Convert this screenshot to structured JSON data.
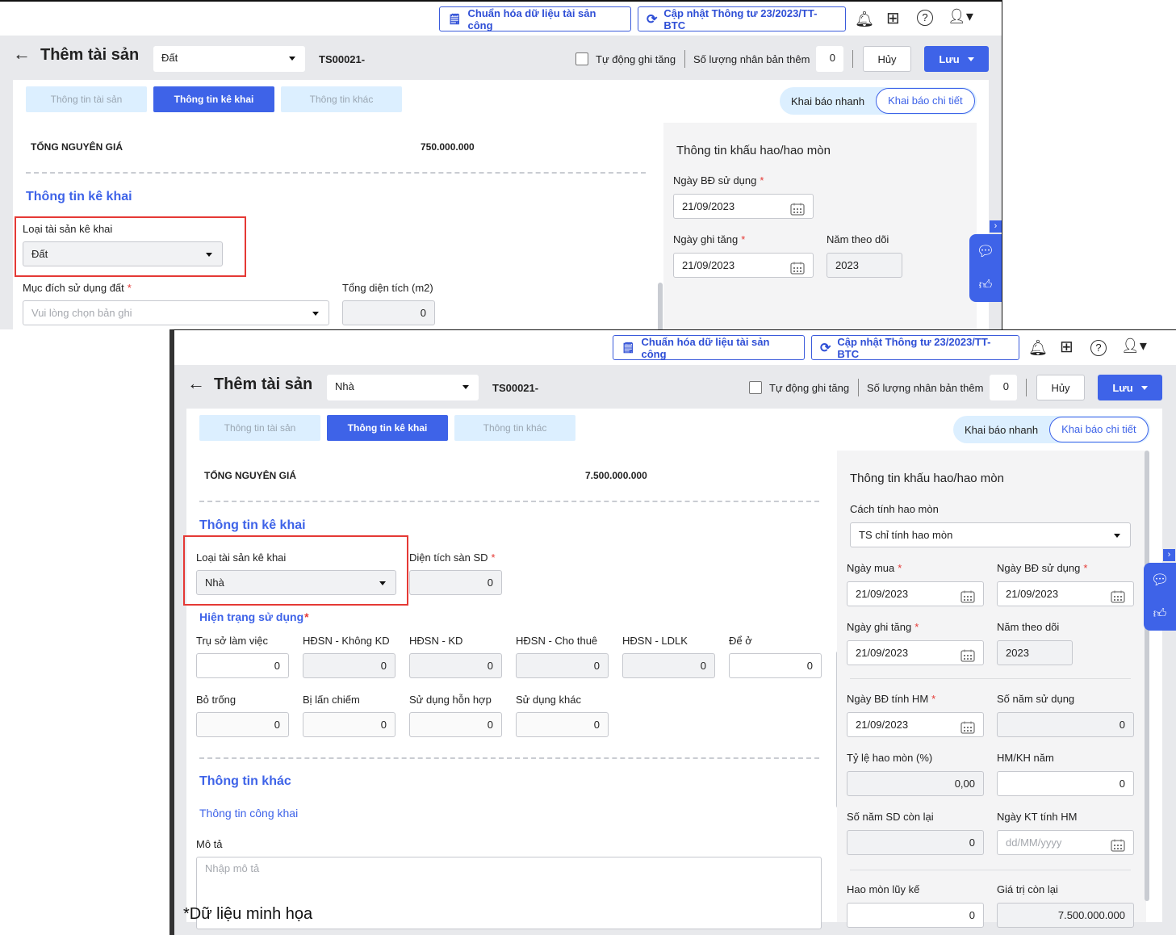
{
  "colors": {
    "accent": "#3e63e8",
    "required": "#e53935",
    "highlight_box": "#e53935",
    "header_bg": "#e8e9ec",
    "tab_inactive": "#dcefff"
  },
  "window1": {
    "topbar": {
      "standardize": "Chuẩn hóa dữ liệu tài sản công",
      "update": "Cập nhật Thông tư 23/2023/TT-BTC",
      "icons": [
        "bell-icon",
        "apps-grid-icon",
        "help-icon",
        "user-icon"
      ]
    },
    "header": {
      "title": "Thêm tài sản",
      "asset_type": "Đất",
      "code": "TS00021-",
      "auto_label": "Tự động ghi tăng",
      "copies_label": "Số lượng nhân bản thêm",
      "copies": "0",
      "cancel": "Hủy",
      "save": "Lưu"
    },
    "tabs": [
      "Thông tin tài sản",
      "Thông tin kê khai",
      "Thông tin khác"
    ],
    "mode": {
      "quick": "Khai báo nhanh",
      "detail": "Khai báo chi tiết"
    },
    "total": {
      "label": "TỔNG NGUYÊN GIÁ",
      "value": "750.000.000"
    },
    "declare": {
      "title": "Thông tin kê khai",
      "type_label": "Loại tài sản kê khai",
      "type_value": "Đất",
      "purpose_label": "Mục đích sử dụng đất",
      "purpose_placeholder": "Vui lòng chọn bản ghi",
      "area_label": "Tổng diện tích (m2)",
      "area": "0"
    },
    "depreciation": {
      "title": "Thông tin khấu hao/hao mòn",
      "start_label": "Ngày BĐ sử dụng",
      "start": "21/09/2023",
      "increase_label": "Ngày ghi tăng",
      "increase": "21/09/2023",
      "year_label": "Năm theo dõi",
      "year": "2023"
    }
  },
  "window2": {
    "topbar": {
      "standardize": "Chuẩn hóa dữ liệu tài sản công",
      "update": "Cập nhật Thông tư 23/2023/TT-BTC"
    },
    "header": {
      "title": "Thêm tài sản",
      "asset_type": "Nhà",
      "code": "TS00021-",
      "auto_label": "Tự động ghi tăng",
      "copies_label": "Số lượng nhân bản thêm",
      "copies": "0",
      "cancel": "Hủy",
      "save": "Lưu"
    },
    "tabs": [
      "Thông tin tài sản",
      "Thông tin kê khai",
      "Thông tin khác"
    ],
    "mode": {
      "quick": "Khai báo nhanh",
      "detail": "Khai báo chi tiết"
    },
    "total": {
      "label": "TỔNG NGUYÊN GIÁ",
      "value": "7.500.000.000"
    },
    "declare": {
      "title": "Thông tin kê khai",
      "type_label": "Loại tài sản kê khai",
      "type_value": "Nhà",
      "floor_area_label": "Diện tích sàn SD",
      "floor_area": "0",
      "status_title": "Hiện trạng sử dụng",
      "status": [
        {
          "label": "Trụ sở làm việc",
          "value": "0"
        },
        {
          "label": "HĐSN - Không KD",
          "value": "0"
        },
        {
          "label": "HĐSN - KD",
          "value": "0"
        },
        {
          "label": "HĐSN - Cho thuê",
          "value": "0"
        },
        {
          "label": "HĐSN - LDLK",
          "value": "0"
        },
        {
          "label": "Để ở",
          "value": "0"
        },
        {
          "label": "Bỏ trống",
          "value": "0"
        },
        {
          "label": "Bị lấn chiếm",
          "value": "0"
        },
        {
          "label": "Sử dụng hỗn hợp",
          "value": "0"
        },
        {
          "label": "Sử dụng khác",
          "value": "0"
        }
      ]
    },
    "other": {
      "title": "Thông tin khác",
      "public_title": "Thông tin công khai",
      "desc_label": "Mô tả",
      "desc_placeholder": "Nhập mô tả"
    },
    "depreciation": {
      "title": "Thông tin khấu hao/hao mòn",
      "method_label": "Cách tính hao mòn",
      "method": "TS chỉ tính hao mòn",
      "buy_label": "Ngày mua",
      "buy": "21/09/2023",
      "start_label": "Ngày BĐ sử dụng",
      "start": "21/09/2023",
      "increase_label": "Ngày ghi tăng",
      "increase": "21/09/2023",
      "year_label": "Năm theo dõi",
      "year": "2023",
      "dep_start_label": "Ngày BĐ tính HM",
      "dep_start": "21/09/2023",
      "years_label": "Số năm sử dụng",
      "years": "0",
      "rate_label": "Tỷ lệ hao mòn (%)",
      "rate": "0,00",
      "annual_label": "HM/KH năm",
      "annual": "0",
      "remaining_label": "Số năm SD còn lại",
      "remaining": "0",
      "end_label": "Ngày KT tính HM",
      "end_placeholder": "dd/MM/yyyy",
      "accum_label": "Hao mòn lũy kế",
      "accum": "0",
      "residual_label": "Giá trị còn lại",
      "residual": "7.500.000.000"
    }
  },
  "footnote": "*Dữ liệu minh họa"
}
